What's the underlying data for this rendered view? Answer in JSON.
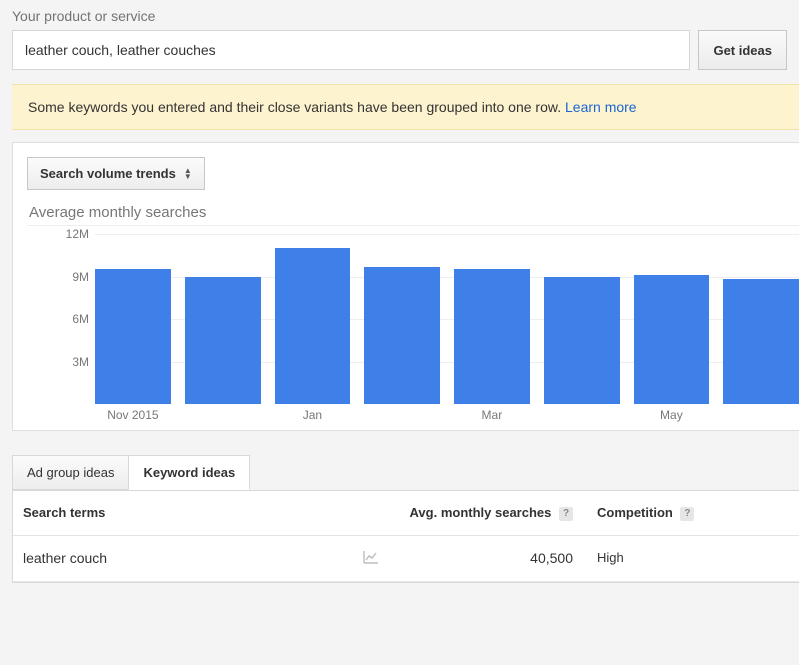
{
  "search": {
    "label": "Your product or service",
    "value": "leather couch, leather couches",
    "button": "Get ideas"
  },
  "notice": {
    "text": "Some keywords you entered and their close variants have been grouped into one row.",
    "link": "Learn more"
  },
  "trends_button": "Search volume trends",
  "chart_data": {
    "type": "bar",
    "title": "Average monthly searches",
    "ylabel": "",
    "ylim": [
      0,
      12
    ],
    "yticks": [
      3,
      6,
      9,
      12
    ],
    "ytick_labels": [
      "3M",
      "6M",
      "9M",
      "12M"
    ],
    "categories": [
      "Nov 2015",
      "",
      "Jan",
      "",
      "Mar",
      "",
      "May",
      ""
    ],
    "values": [
      9.5,
      9.0,
      11.0,
      9.7,
      9.5,
      9.0,
      9.1,
      8.8
    ],
    "bar_color": "#3f7fe8"
  },
  "tabs": {
    "adgroup": "Ad group ideas",
    "keyword": "Keyword ideas",
    "active": "keyword"
  },
  "table": {
    "headers": {
      "terms": "Search terms",
      "avg": "Avg. monthly searches",
      "comp": "Competition"
    },
    "rows": [
      {
        "term": "leather couch",
        "avg": "40,500",
        "competition": "High"
      }
    ]
  }
}
